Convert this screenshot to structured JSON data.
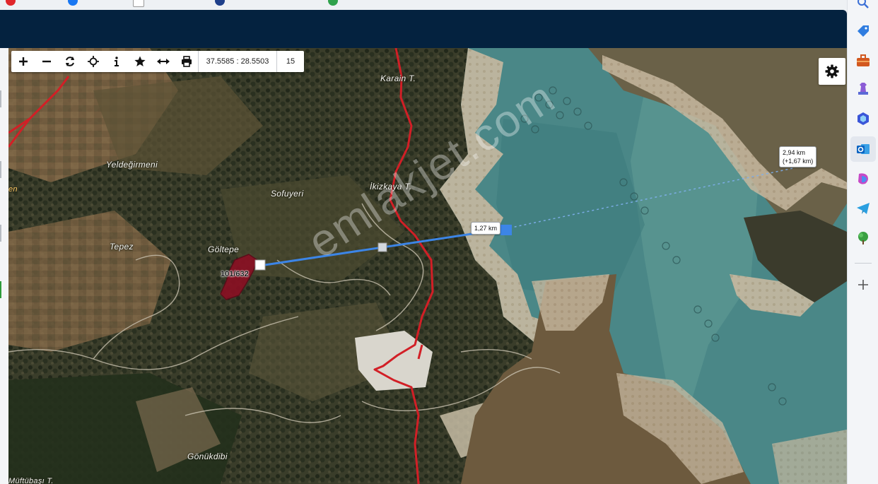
{
  "map": {
    "coords": "37.5585 : 28.5503",
    "zoom": "15",
    "watermark": "emlakjet.com",
    "parcel_label": "101/632",
    "places": [
      {
        "name": "Karain T.",
        "key": "karain"
      },
      {
        "name": "Yeldeğirmeni",
        "key": "yeldegirmeni"
      },
      {
        "name": "Sofuyeri",
        "key": "sofuyeri"
      },
      {
        "name": "İkizkaya T.",
        "key": "ikizkaya"
      },
      {
        "name": "Tepez",
        "key": "tepez"
      },
      {
        "name": "Göltepe",
        "key": "goltepe"
      },
      {
        "name": "Gönükdibi",
        "key": "gonukdibi"
      },
      {
        "name": "Müftübaşı T.",
        "key": "muftubasi"
      },
      {
        "name": "en",
        "key": "edge"
      }
    ],
    "measurements": [
      {
        "label": "1,27 km"
      },
      {
        "label": "2,94 km",
        "sub": "(+1,67 km)"
      }
    ],
    "colors": {
      "boundary": "#d21f26",
      "measure_line": "#3c85e6",
      "parcel": "#8b0f23",
      "water": "#3f7f7f"
    }
  },
  "toolbar": {
    "buttons": [
      {
        "name": "zoom-in",
        "icon": "plus-icon"
      },
      {
        "name": "zoom-out",
        "icon": "minus-icon"
      },
      {
        "name": "refresh",
        "icon": "refresh-icon"
      },
      {
        "name": "locate",
        "icon": "crosshair-icon"
      },
      {
        "name": "info",
        "icon": "info-icon"
      },
      {
        "name": "favorite",
        "icon": "star-icon"
      },
      {
        "name": "measure",
        "icon": "measure-icon"
      },
      {
        "name": "print",
        "icon": "printer-icon"
      }
    ]
  },
  "sidebar": {
    "icons": [
      "search-icon",
      "tag-icon",
      "briefcase-icon",
      "chess-icon",
      "hexagon-icon",
      "outlook-icon",
      "copilot-icon",
      "telegram-icon",
      "tree-icon",
      "add-icon"
    ]
  }
}
